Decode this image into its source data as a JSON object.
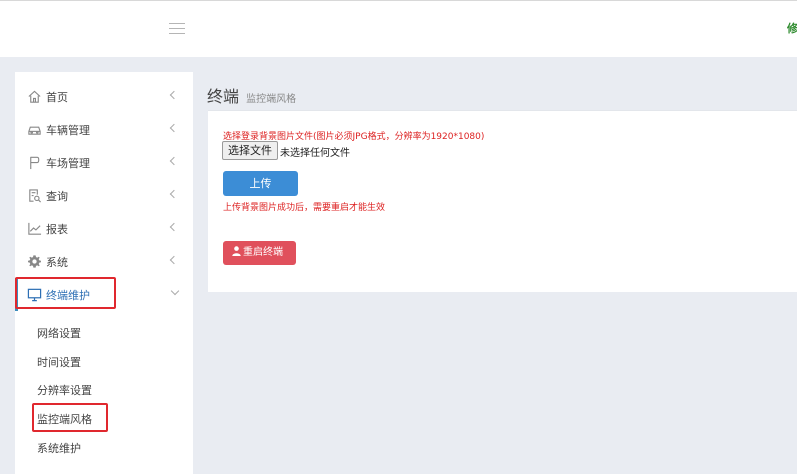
{
  "header": {
    "right_text": "修"
  },
  "sidebar": {
    "items": [
      {
        "label": "首页",
        "icon": "home-icon"
      },
      {
        "label": "车辆管理",
        "icon": "car-icon"
      },
      {
        "label": "车场管理",
        "icon": "flag-icon"
      },
      {
        "label": "查询",
        "icon": "search-doc-icon"
      },
      {
        "label": "报表",
        "icon": "line-chart-icon"
      },
      {
        "label": "系统",
        "icon": "gear-icon"
      },
      {
        "label": "终端维护",
        "icon": "monitor-icon",
        "active": true
      }
    ],
    "submenu": [
      {
        "label": "网络设置"
      },
      {
        "label": "时间设置"
      },
      {
        "label": "分辨率设置"
      },
      {
        "label": "监控端风格",
        "selected": true
      },
      {
        "label": "系统维护"
      }
    ]
  },
  "content": {
    "title": "终端",
    "subtitle": "监控端风格"
  },
  "form": {
    "hint": "选择登录背景图片文件(图片必须JPG格式，分辨率为1920*1080)",
    "file_button": "选择文件",
    "file_status": "未选择任何文件",
    "upload_button": "上传",
    "upload_hint": "上传背景图片成功后，需要重启才能生效",
    "reboot_button": "重启终端"
  },
  "colors": {
    "accent": "#3c8dd6",
    "danger": "#e0505c",
    "hint_red": "#dd2222",
    "highlight": "#e0282e",
    "active_text": "#2d6fb4"
  }
}
